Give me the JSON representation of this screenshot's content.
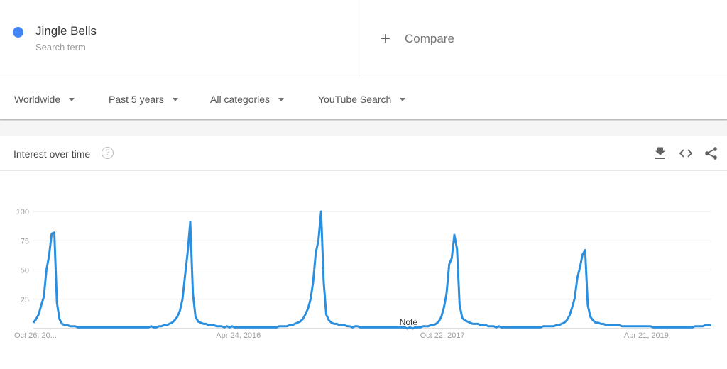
{
  "search_term": {
    "name": "Jingle Bells",
    "subtitle": "Search term",
    "color": "#4285f4"
  },
  "compare": {
    "icon": "plus-icon",
    "label": "Compare"
  },
  "filters": [
    {
      "label": "Worldwide"
    },
    {
      "label": "Past 5 years"
    },
    {
      "label": "All categories"
    },
    {
      "label": "YouTube Search"
    }
  ],
  "card": {
    "title": "Interest over time",
    "help_icon": "?",
    "actions": [
      "download-icon",
      "embed-icon",
      "share-icon"
    ]
  },
  "chart_data": {
    "type": "line",
    "title": "Interest over time",
    "xlabel": "",
    "ylabel": "",
    "ylim": [
      0,
      100
    ],
    "yticks": [
      25,
      50,
      75,
      100
    ],
    "grid": true,
    "legend": "none",
    "x_tick_labels": [
      {
        "label": "Oct 26, 20...",
        "week_index": 0
      },
      {
        "label": "Apr 24, 2016",
        "week_index": 78
      },
      {
        "label": "Oct 22, 2017",
        "week_index": 156
      },
      {
        "label": "Apr 21, 2019",
        "week_index": 234
      }
    ],
    "annotations": [
      {
        "label": "Note",
        "week_index": 143
      }
    ],
    "series": [
      {
        "name": "Jingle Bells",
        "color": "#2b8fe0",
        "x_unit": "week since Oct 26, 2014",
        "values": [
          5,
          8,
          12,
          20,
          27,
          50,
          62,
          81,
          82,
          22,
          8,
          4,
          3,
          3,
          2,
          2,
          2,
          1,
          1,
          1,
          1,
          1,
          1,
          1,
          1,
          1,
          1,
          1,
          1,
          1,
          1,
          1,
          1,
          1,
          1,
          1,
          1,
          1,
          1,
          1,
          1,
          1,
          1,
          1,
          1,
          2,
          1,
          1,
          2,
          2,
          3,
          3,
          4,
          5,
          7,
          10,
          15,
          25,
          45,
          65,
          91,
          30,
          10,
          6,
          5,
          4,
          4,
          3,
          3,
          3,
          2,
          2,
          2,
          1,
          2,
          1,
          2,
          1,
          1,
          1,
          1,
          1,
          1,
          1,
          1,
          1,
          1,
          1,
          1,
          1,
          1,
          1,
          1,
          1,
          2,
          2,
          2,
          2,
          3,
          3,
          4,
          5,
          6,
          8,
          12,
          17,
          25,
          40,
          65,
          75,
          100,
          40,
          12,
          7,
          5,
          4,
          4,
          3,
          3,
          3,
          2,
          2,
          1,
          2,
          2,
          1,
          1,
          1,
          1,
          1,
          1,
          1,
          1,
          1,
          1,
          1,
          1,
          1,
          1,
          1,
          1,
          1,
          1,
          0,
          1,
          0,
          1,
          1,
          1,
          2,
          2,
          2,
          3,
          3,
          4,
          6,
          10,
          18,
          30,
          55,
          60,
          80,
          68,
          20,
          9,
          7,
          6,
          5,
          4,
          4,
          4,
          3,
          3,
          3,
          2,
          2,
          2,
          1,
          2,
          1,
          1,
          1,
          1,
          1,
          1,
          1,
          1,
          1,
          1,
          1,
          1,
          1,
          1,
          1,
          1,
          2,
          2,
          2,
          2,
          2,
          3,
          3,
          4,
          5,
          7,
          11,
          18,
          26,
          43,
          52,
          63,
          67,
          20,
          10,
          7,
          5,
          5,
          4,
          4,
          3,
          3,
          3,
          3,
          3,
          3,
          2,
          2,
          2,
          2,
          2,
          2,
          2,
          2,
          2,
          2,
          2,
          2,
          1,
          1,
          1,
          1,
          1,
          1,
          1,
          1,
          1,
          1,
          1,
          1,
          1,
          1,
          1,
          1,
          2,
          2,
          2,
          2,
          3,
          3,
          3
        ]
      }
    ]
  }
}
